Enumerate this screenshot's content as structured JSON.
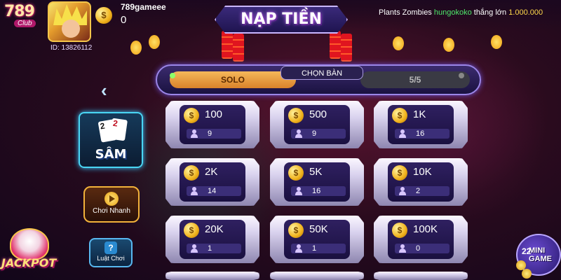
{
  "header": {
    "logo_number": "789",
    "logo_club": "Club",
    "user_id": "ID: 13826112",
    "username": "789gameee",
    "balance": "0",
    "coin_symbol": "$",
    "title": "NẠP TIỀN",
    "ticker": {
      "game": "Plants Zombies ",
      "player": "hungokoko",
      "action": " thắng lớn ",
      "amount": "1.000.000"
    }
  },
  "tabs": {
    "solo": "SOLO",
    "choose_table": "CHỌN BÀN",
    "count": "5/5"
  },
  "left_panel": {
    "game_card": {
      "name": "SÂM",
      "card1": "2",
      "card2": "2"
    },
    "quick_play": "Chơi Nhanh",
    "rules": "Luật Chơi",
    "rules_icon": "?"
  },
  "jackpot": {
    "label": "JACKPOT"
  },
  "minigame": {
    "count": "22",
    "label_line1": "MINI",
    "label_line2": "GAME"
  },
  "tables": [
    {
      "bet": "100",
      "players": "9"
    },
    {
      "bet": "500",
      "players": "9"
    },
    {
      "bet": "1K",
      "players": "16"
    },
    {
      "bet": "2K",
      "players": "14"
    },
    {
      "bet": "5K",
      "players": "16"
    },
    {
      "bet": "10K",
      "players": "2"
    },
    {
      "bet": "20K",
      "players": "1"
    },
    {
      "bet": "50K",
      "players": "1"
    },
    {
      "bet": "100K",
      "players": "0"
    }
  ],
  "colors": {
    "accent": "#9b86e8",
    "gold": "#f0b21c",
    "ticker_player": "#4ee86a",
    "ticker_amount": "#ffd94a"
  }
}
